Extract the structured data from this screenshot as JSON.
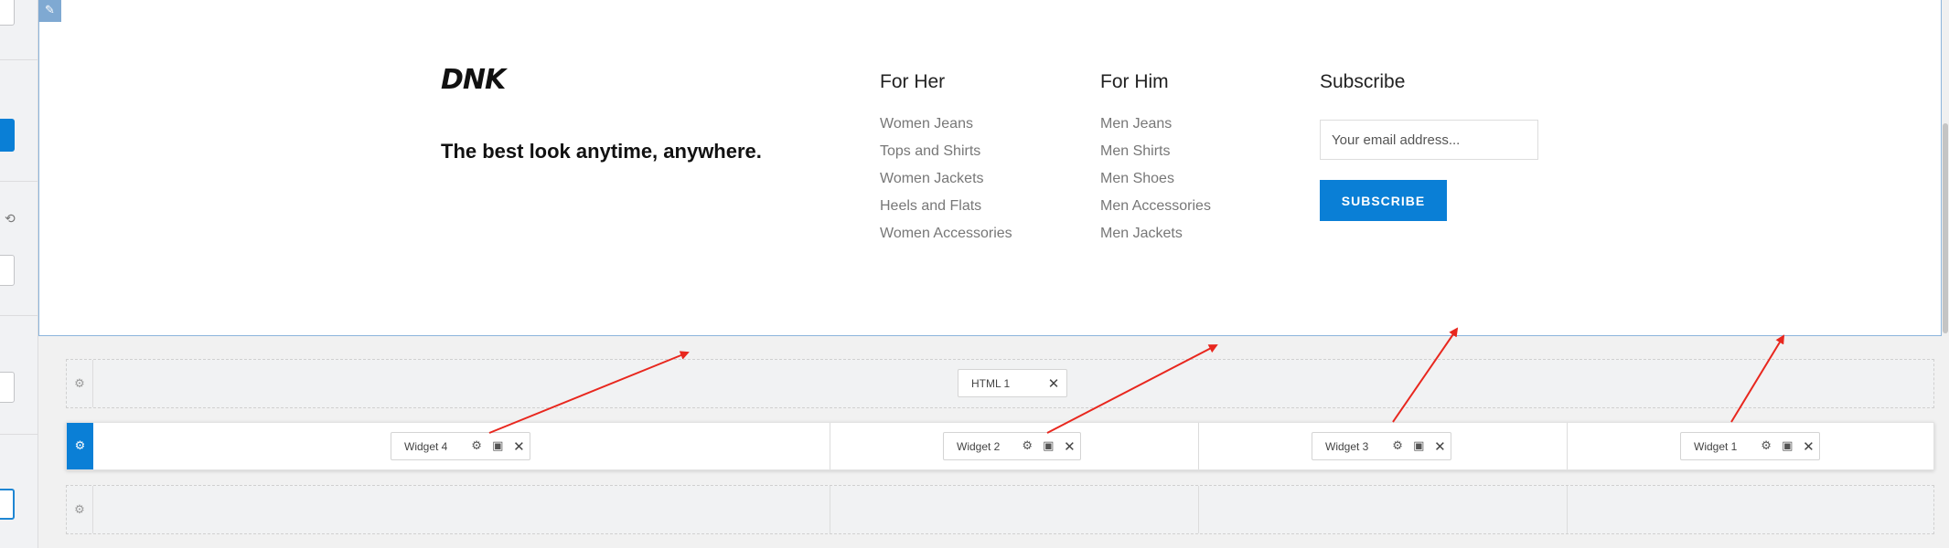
{
  "editor": {
    "edit_icon": "pencil-icon",
    "undo_icon": "undo-icon"
  },
  "footer": {
    "logo": "DNK",
    "tagline": "The best look anytime, anywhere.",
    "columns": [
      {
        "title": "For Her",
        "links": [
          "Women Jeans",
          "Tops and Shirts",
          "Women Jackets",
          "Heels and Flats",
          "Women Accessories"
        ]
      },
      {
        "title": "For Him",
        "links": [
          "Men Jeans",
          "Men Shirts",
          "Men Shoes",
          "Men Accessories",
          "Men Jackets"
        ]
      }
    ],
    "subscribe": {
      "title": "Subscribe",
      "placeholder": "Your email address...",
      "button": "SUBSCRIBE"
    }
  },
  "builder": {
    "row_gear_icon": "gear-icon",
    "rows": [
      {
        "widgets": [
          {
            "label": "HTML 1",
            "close": "✕"
          }
        ]
      },
      {
        "widgets": [
          {
            "label": "Widget 4",
            "close": "✕"
          },
          {
            "label": "Widget 2",
            "close": "✕"
          },
          {
            "label": "Widget 3",
            "close": "✕"
          },
          {
            "label": "Widget 1",
            "close": "✕"
          }
        ]
      },
      {
        "widgets": []
      }
    ],
    "widget_icons": [
      "gear-icon",
      "layout-icon",
      "close-icon"
    ]
  },
  "colors": {
    "accent": "#0a7fd6",
    "arrow": "#e8271e",
    "preview_border": "#8cb5dc"
  }
}
